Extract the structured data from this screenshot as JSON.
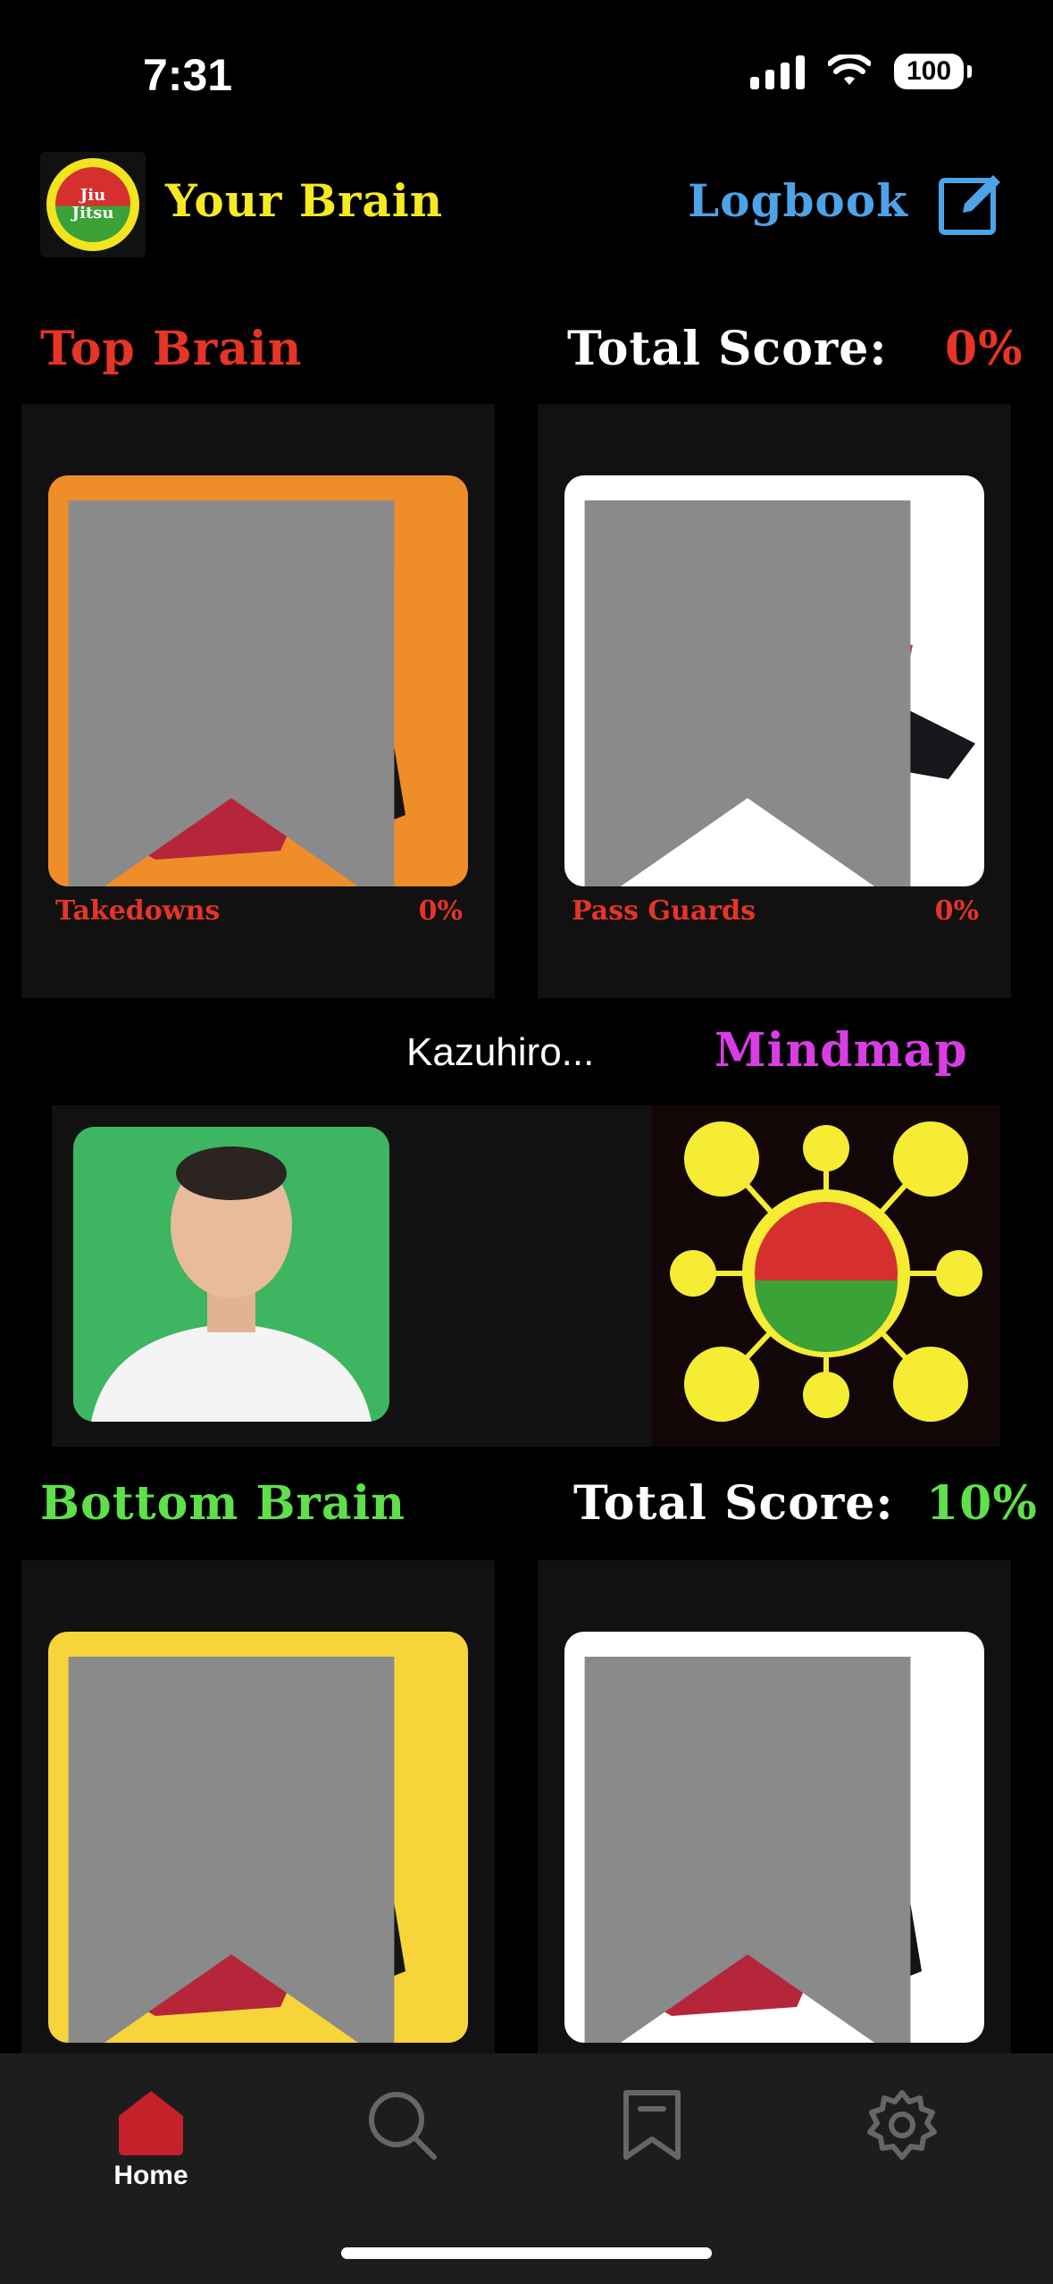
{
  "status_bar": {
    "time": "7:31",
    "battery": "100"
  },
  "header": {
    "title": "Your Brain",
    "logbook_label": "Logbook",
    "logo_text": [
      "Jiu",
      "Jitsu"
    ]
  },
  "top_section": {
    "title": "Top Brain",
    "score_label": "Total Score:",
    "score_value": "0%",
    "title_color": "#e63427",
    "score_color": "#e63427",
    "cards": [
      {
        "label": "Takedowns",
        "percent": "0%",
        "bg": "#ef8d2a"
      },
      {
        "label": "Pass Guards",
        "percent": "0%",
        "bg": "#ffffff"
      }
    ]
  },
  "middle": {
    "instructor_name": "Kazuhiro...",
    "mindmap_label": "Mindmap"
  },
  "bottom_section": {
    "title": "Bottom Brain",
    "score_label": "Total Score:",
    "score_value": "10%",
    "title_color": "#5fe04b",
    "score_color": "#5fe04b",
    "cards": [
      {
        "bg": "#f6d43a"
      },
      {
        "bg": "#ffffff"
      }
    ]
  },
  "tabbar": {
    "items": [
      {
        "label": "Home",
        "icon": "home-icon",
        "active": true
      },
      {
        "label": "",
        "icon": "search-icon",
        "active": false
      },
      {
        "label": "",
        "icon": "bookmark-icon",
        "active": false
      },
      {
        "label": "",
        "icon": "settings-icon",
        "active": false
      }
    ],
    "active_color": "#c4212a"
  }
}
